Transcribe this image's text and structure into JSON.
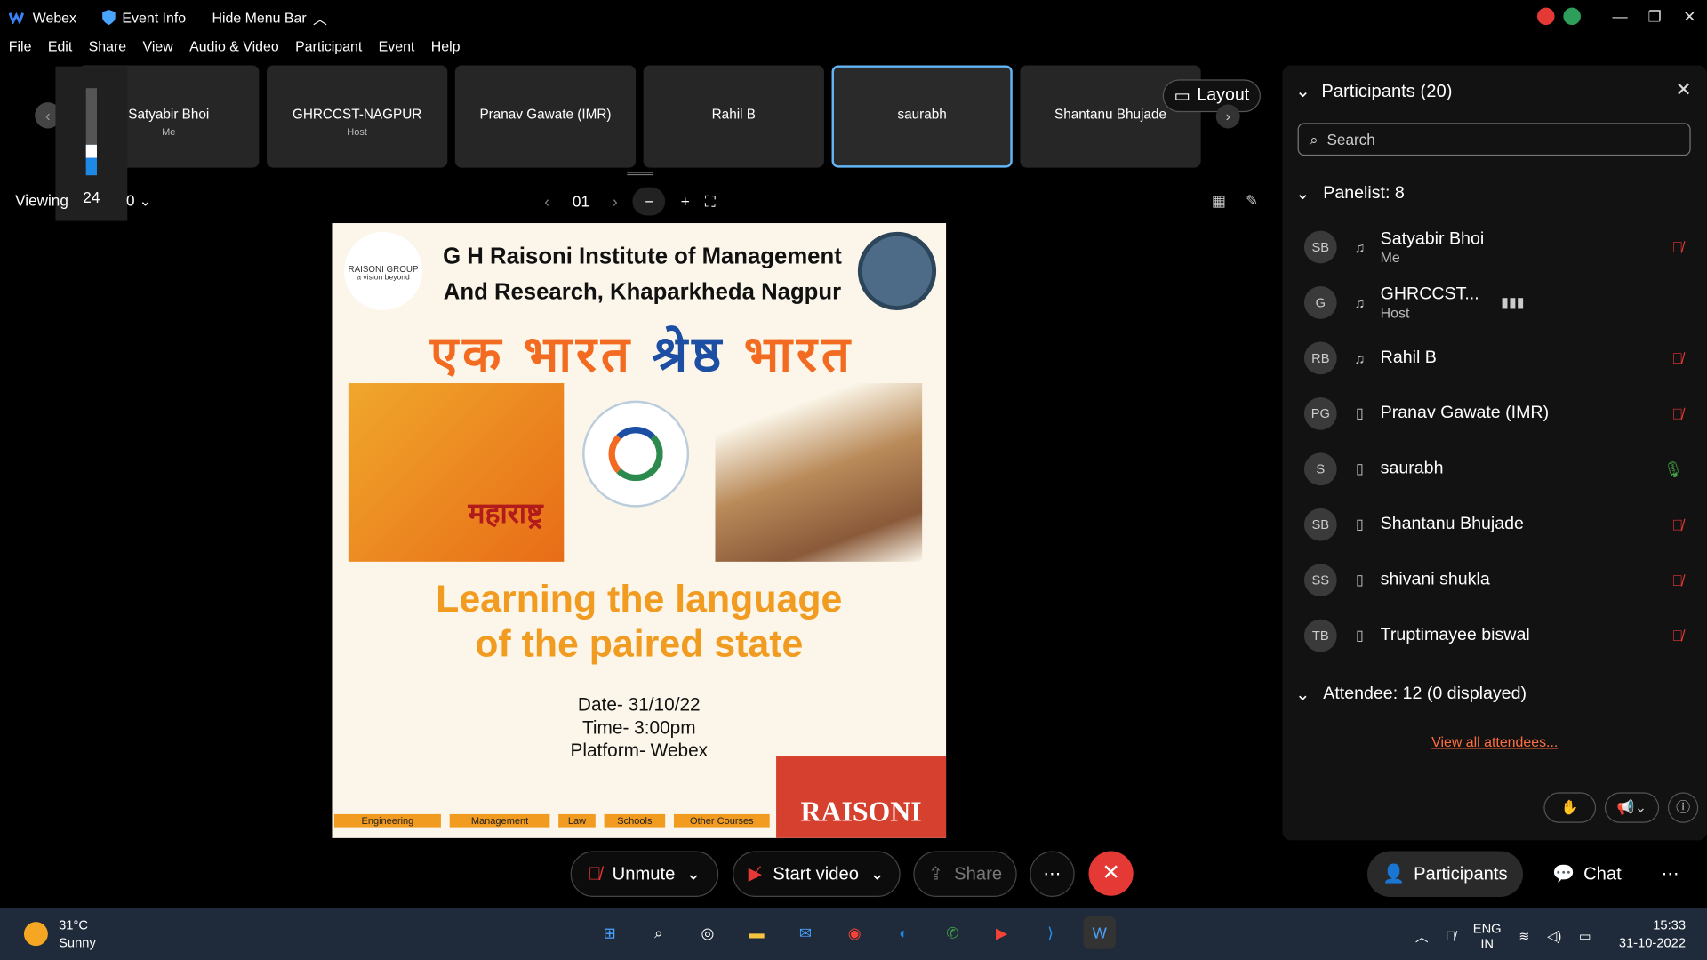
{
  "titlebar": {
    "app_name": "Webex",
    "event_info": "Event Info",
    "hide_menu_bar": "Hide Menu Bar"
  },
  "menu": [
    "File",
    "Edit",
    "Share",
    "View",
    "Audio & Video",
    "Participant",
    "Event",
    "Help"
  ],
  "volume_level": "24",
  "tiles": [
    {
      "name": "Satyabir Bhoi",
      "sub": "Me"
    },
    {
      "name": "GHRCCST-NAGPUR",
      "sub": "Host"
    },
    {
      "name": "Pranav Gawate (IMR)",
      "sub": ""
    },
    {
      "name": "Rahil B",
      "sub": ""
    },
    {
      "name": "saurabh",
      "sub": ""
    },
    {
      "name": "Shantanu Bhujade",
      "sub": ""
    }
  ],
  "layout_label": "Layout",
  "viewing_label": "Viewing",
  "viewing_value": "0",
  "page_number": "01",
  "slide": {
    "institute_line1": "G H Raisoni Institute of Management",
    "institute_line2": "And Research, Khaparkheda Nagpur",
    "logo_text": "RAISONI GROUP",
    "logo_tagline": "a vision beyond",
    "hindi_part1": "एक भारत",
    "hindi_part2": "श्रेष्ठ",
    "hindi_part3": "भारत",
    "maharashtra": "महाराष्ट्र",
    "learn_line1": "Learning the language",
    "learn_line2": "of the paired state",
    "date": "Date- 31/10/22",
    "time": "Time- 3:00pm",
    "platform": "Platform- Webex",
    "footer_items": [
      "Engineering",
      "Management",
      "Law",
      "Schools",
      "Other Courses"
    ],
    "raisoni": "RAISONI"
  },
  "panel": {
    "title": "Participants (20)",
    "search_placeholder": "Search",
    "panelist_header": "Panelist: 8",
    "attendee_header": "Attendee: 12 (0 displayed)",
    "view_all": "View all attendees...",
    "participants": [
      {
        "initials": "SB",
        "name": "Satyabir Bhoi",
        "sub": "Me",
        "mic": "muted"
      },
      {
        "initials": "G",
        "name": "GHRCCST...",
        "sub": "Host",
        "mic": "speaking"
      },
      {
        "initials": "RB",
        "name": "Rahil B",
        "sub": "",
        "mic": "muted"
      },
      {
        "initials": "PG",
        "name": "Pranav Gawate (IMR)",
        "sub": "",
        "mic": "muted"
      },
      {
        "initials": "S",
        "name": "saurabh",
        "sub": "",
        "mic": "on"
      },
      {
        "initials": "SB",
        "name": "Shantanu Bhujade",
        "sub": "",
        "mic": "muted"
      },
      {
        "initials": "SS",
        "name": "shivani shukla",
        "sub": "",
        "mic": "muted"
      },
      {
        "initials": "TB",
        "name": "Truptimayee biswal",
        "sub": "",
        "mic": "muted"
      }
    ]
  },
  "controls": {
    "unmute": "Unmute",
    "start_video": "Start video",
    "share": "Share",
    "participants": "Participants",
    "chat": "Chat"
  },
  "taskbar": {
    "temp": "31°C",
    "weather": "Sunny",
    "lang1": "ENG",
    "lang2": "IN",
    "time": "15:33",
    "date": "31-10-2022"
  },
  "colors": {
    "accent_blue": "#64b5f6",
    "end_red": "#e53935",
    "slide_orange": "#f29b21"
  }
}
